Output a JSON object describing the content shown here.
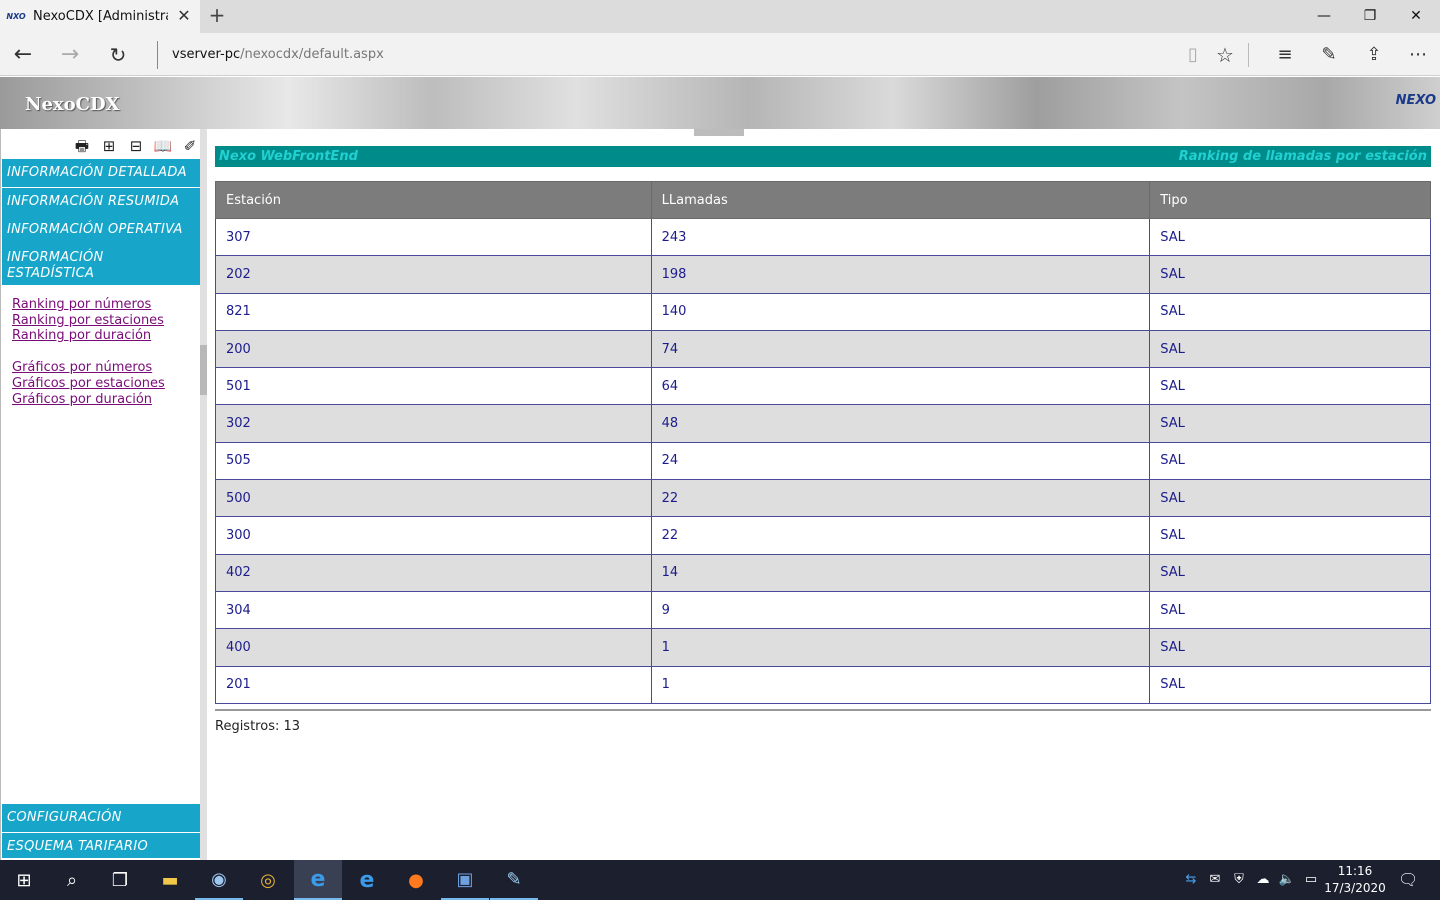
{
  "browser": {
    "tab_title": "NexoCDX [Administrado",
    "tab_favicon": "nexo-favicon",
    "url_host": "vserver-pc",
    "url_path": "/nexocdx/default.aspx",
    "window_controls": {
      "minimize": "—",
      "restore": "❐",
      "close": "✕"
    }
  },
  "header": {
    "brand": "NexoCDX",
    "logo": "NEXO"
  },
  "sidebar": {
    "menu": [
      {
        "label": "INFORMACIÓN DETALLADA"
      },
      {
        "label": "INFORMACIÓN RESUMIDA"
      },
      {
        "label": "INFORMACIÓN OPERATIVA"
      },
      {
        "label": "INFORMACIÓN ESTADÍSTICA"
      }
    ],
    "links_ranking": [
      "Ranking por números",
      "Ranking por estaciones",
      "Ranking por duración"
    ],
    "links_graficos": [
      "Gráficos por números",
      "Gráficos por estaciones",
      "Gráficos por duración"
    ],
    "bottom_menu": [
      {
        "label": "CONFIGURACIÓN"
      },
      {
        "label": "ESQUEMA TARIFARIO"
      }
    ]
  },
  "main": {
    "banner_left": "Nexo WebFrontEnd",
    "banner_right": "Ranking de llamadas por estación",
    "columns": [
      "Estación",
      "LLamadas",
      "Tipo"
    ],
    "rows": [
      [
        "307",
        "243",
        "SAL"
      ],
      [
        "202",
        "198",
        "SAL"
      ],
      [
        "821",
        "140",
        "SAL"
      ],
      [
        "200",
        "74",
        "SAL"
      ],
      [
        "501",
        "64",
        "SAL"
      ],
      [
        "302",
        "48",
        "SAL"
      ],
      [
        "505",
        "24",
        "SAL"
      ],
      [
        "500",
        "22",
        "SAL"
      ],
      [
        "300",
        "22",
        "SAL"
      ],
      [
        "402",
        "14",
        "SAL"
      ],
      [
        "304",
        "9",
        "SAL"
      ],
      [
        "400",
        "1",
        "SAL"
      ],
      [
        "201",
        "1",
        "SAL"
      ]
    ],
    "records": "Registros: 13"
  },
  "taskbar": {
    "clock_time": "11:16",
    "clock_date": "17/3/2020"
  },
  "colors": {
    "menu_bg": "#17a6c9",
    "banner_bg": "#008b8b",
    "banner_text": "#21d1d1",
    "table_header": "#7c7c7c",
    "cell_text": "#1c1c8c",
    "link": "#7a0c7a"
  }
}
